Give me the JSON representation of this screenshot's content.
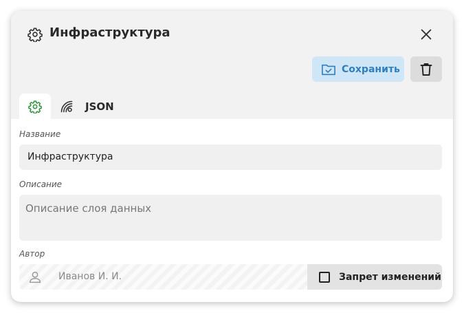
{
  "dialog": {
    "title": "Инфраструктура",
    "title_icon": "gear-icon",
    "close_icon": "close-icon"
  },
  "toolbar": {
    "save_label": "Сохранить",
    "save_icon": "folder-check-icon",
    "delete_icon": "trash-icon"
  },
  "tabs": [
    {
      "id": "settings",
      "icon": "gear-icon",
      "active": true
    },
    {
      "id": "source",
      "icon": "signal-icon",
      "active": false
    },
    {
      "id": "json",
      "label": "JSON",
      "active": false
    }
  ],
  "form": {
    "name_label": "Название",
    "name_value": "Инфраструктура",
    "description_label": "Описание",
    "description_placeholder": "Описание слоя данных",
    "author_label": "Автор",
    "author_value": "Иванов И. И.",
    "author_icon": "user-icon",
    "lock_label": "Запрет изменений",
    "lock_checked": false
  },
  "colors": {
    "accent_active_tab_icon": "#2e9a3e",
    "save_button_bg": "#cfe6f7",
    "save_button_text": "#2f7fc0"
  }
}
